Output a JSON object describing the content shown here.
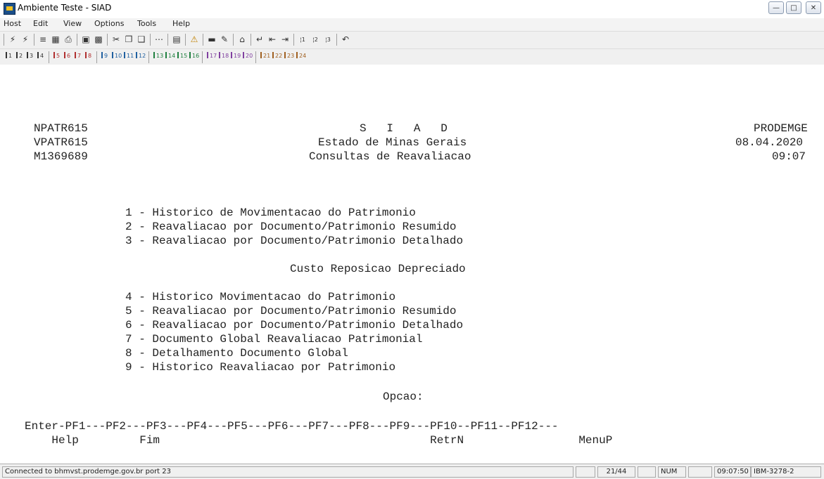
{
  "window": {
    "title": "Ambiente Teste - SIAD"
  },
  "menu": [
    "Host",
    "Edit",
    "View",
    "Options",
    "Tools",
    "Help"
  ],
  "toolbar_icons": [
    "connect-icon",
    "disconnect-icon",
    "send-icon",
    "receive-icon",
    "print-icon",
    "copy-screen-icon",
    "paste-screen-icon",
    "cut-icon",
    "copy-icon",
    "paste-icon",
    "keypad-icon",
    "chart-icon",
    "warning-icon",
    "screen-icon",
    "highlight-icon",
    "home-icon",
    "enter-icon",
    "backtab-icon",
    "tab-icon",
    "pa1-icon",
    "pa2-icon",
    "pa3-icon",
    "undo-icon"
  ],
  "pf_keys": [
    "1",
    "2",
    "3",
    "4",
    "5",
    "6",
    "7",
    "8",
    "9",
    "10",
    "11",
    "12",
    "13",
    "14",
    "15",
    "16",
    "17",
    "18",
    "19",
    "20",
    "21",
    "22",
    "23",
    "24"
  ],
  "pf_colors": [
    "#333333",
    "#333333",
    "#333333",
    "#333333",
    "#b03030",
    "#b03030",
    "#b03030",
    "#b03030",
    "#2060a0",
    "#2060a0",
    "#2060a0",
    "#2060a0",
    "#208040",
    "#208040",
    "#208040",
    "#208040",
    "#8040a0",
    "#8040a0",
    "#8040a0",
    "#8040a0",
    "#a06020",
    "#a06020",
    "#a06020",
    "#a06020"
  ],
  "terminal": {
    "header_left": [
      "NPATR615",
      "VPATR615",
      "M1369689"
    ],
    "header_center": [
      "S   I   A   D",
      "Estado de Minas Gerais",
      "Consultas de Reavaliacao"
    ],
    "header_right": [
      "PRODEMGE",
      "08.04.2020",
      "09:07"
    ],
    "options_group1": [
      "1 - Historico de Movimentacao do Patrimonio",
      "2 - Reavaliacao por Documento/Patrimonio Resumido",
      "3 - Reavaliacao por Documento/Patrimonio Detalhado"
    ],
    "section_title": "Custo Reposicao Depreciado",
    "options_group2": [
      "4 - Historico Movimentacao do Patrimonio",
      "5 - Reavaliacao por Documento/Patrimonio Resumido",
      "6 - Reavaliacao por Documento/Patrimonio Detalhado",
      "7 - Documento Global Reavaliacao Patrimonial",
      "8 - Detalhamento Documento Global",
      "9 - Historico Reavaliacao por Patrimonio"
    ],
    "prompt": "Opcao:",
    "pf_line": "Enter-PF1---PF2---PF3---PF4---PF5---PF6---PF7---PF8---PF9---PF10--PF11--PF12---",
    "pf_labels": "    Help         Fim                                        RetrN                 MenuP"
  },
  "status": {
    "connection": "Connected to bhmvst.prodemge.gov.br port 23",
    "cursor": "21/44",
    "num": "NUM",
    "time": "09:07:50",
    "model": "IBM-3278-2"
  }
}
